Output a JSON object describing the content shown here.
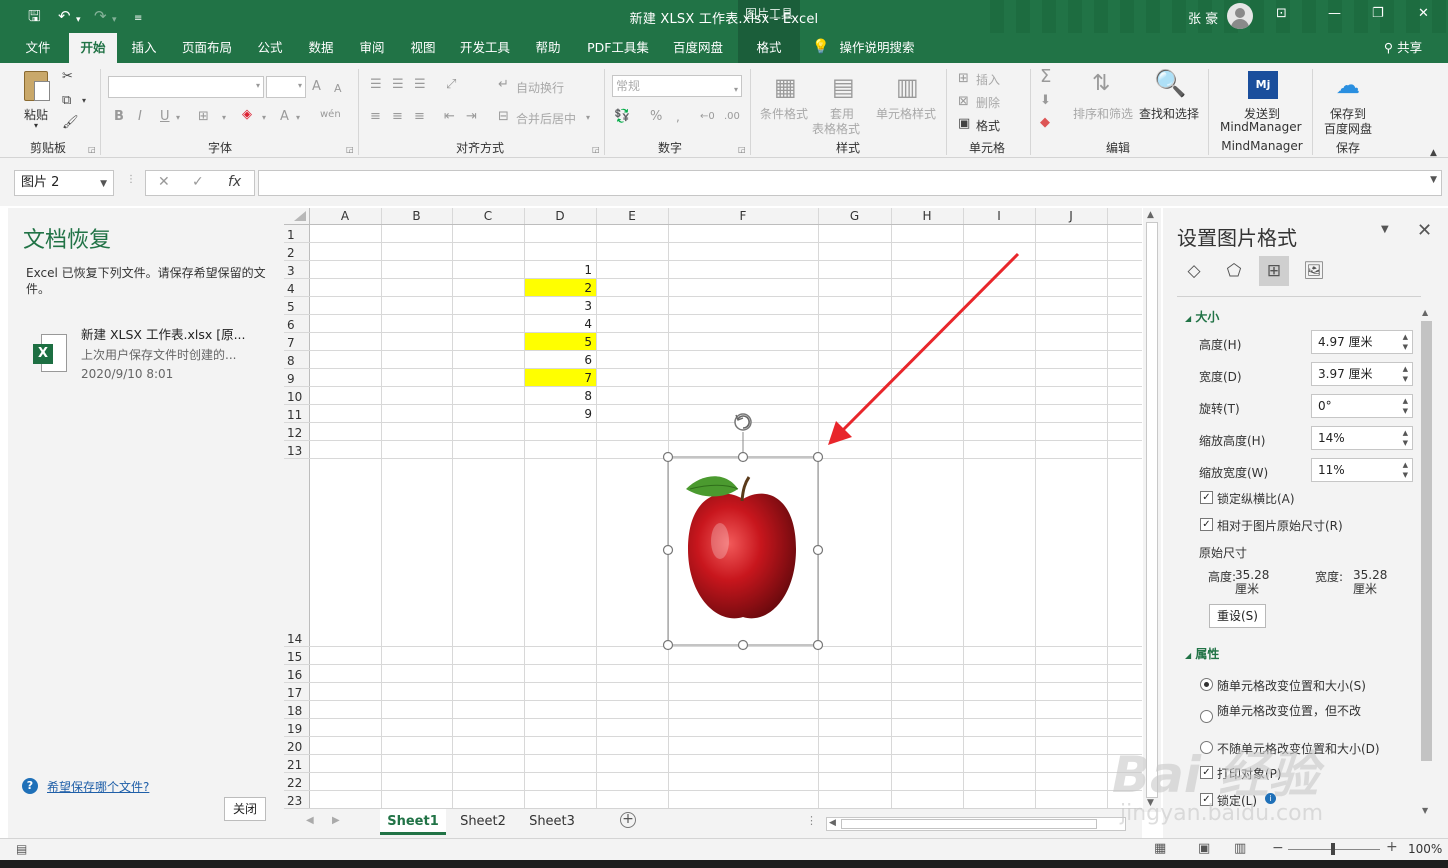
{
  "titlebar": {
    "title": "新建 XLSX 工作表.xlsx  -  Excel",
    "context_tab_group": "图片工具",
    "user_name": "张 豪"
  },
  "tabs": [
    "文件",
    "开始",
    "插入",
    "页面布局",
    "公式",
    "数据",
    "审阅",
    "视图",
    "开发工具",
    "帮助",
    "PDF工具集",
    "百度网盘",
    "格式"
  ],
  "active_tab": "开始",
  "tell_me": "操作说明搜索",
  "share": "共享",
  "ribbon": {
    "clipboard": {
      "paste": "粘贴",
      "label": "剪贴板"
    },
    "font": {
      "label": "字体",
      "bold": "B",
      "italic": "I",
      "underline": "U",
      "wen": "wén",
      "grow": "A",
      "shrink": "A"
    },
    "align": {
      "label": "对齐方式",
      "wrap": "自动换行",
      "merge": "合并后居中"
    },
    "number": {
      "label": "数字",
      "format": "常规",
      "percent": "%"
    },
    "styles": {
      "label": "样式",
      "cond": "条件格式",
      "table1": "套用",
      "table2": "表格格式",
      "cell": "单元格样式"
    },
    "cells": {
      "label": "单元格",
      "insert": "插入",
      "delete": "删除",
      "format": "格式"
    },
    "editing": {
      "label": "编辑",
      "sort": "排序和筛选",
      "find": "查找和选择"
    },
    "mindmanager": {
      "label": "MindManager",
      "send1": "发送到",
      "send2": "MindManager"
    },
    "save": {
      "label": "保存",
      "save1": "保存到",
      "save2": "百度网盘"
    }
  },
  "namebox": "图片 2",
  "fx": "fx",
  "recovery": {
    "title": "文档恢复",
    "desc": "Excel 已恢复下列文件。请保存希望保留的文件。",
    "file_name": "新建 XLSX 工作表.xlsx  [原...",
    "file_desc": "上次用户保存文件时创建的...",
    "file_date": "2020/9/10 8:01",
    "help_link": "希望保存哪个文件?",
    "close": "关闭"
  },
  "grid": {
    "columns": [
      "A",
      "B",
      "C",
      "D",
      "E",
      "F",
      "G",
      "H",
      "I",
      "J"
    ],
    "rows": [
      "1",
      "2",
      "3",
      "4",
      "5",
      "6",
      "7",
      "8",
      "9",
      "10",
      "11",
      "12",
      "13",
      "14",
      "15",
      "16",
      "17",
      "18",
      "19",
      "20",
      "21",
      "22",
      "23"
    ],
    "d_values": [
      "1",
      "2",
      "3",
      "4",
      "5",
      "6",
      "7",
      "8",
      "9"
    ],
    "highlight_rows": [
      4,
      7,
      9
    ],
    "highlight_color": "#ffff00"
  },
  "sheets": [
    "Sheet1",
    "Sheet2",
    "Sheet3"
  ],
  "active_sheet": "Sheet1",
  "zoom": "100%",
  "format_pane": {
    "title": "设置图片格式",
    "size_section": "大小",
    "height_label": "高度(H)",
    "height_value": "4.97 厘米",
    "width_label": "宽度(D)",
    "width_value": "3.97 厘米",
    "rotate_label": "旋转(T)",
    "rotate_value": "0°",
    "scale_h_label": "缩放高度(H)",
    "scale_h_value": "14%",
    "scale_w_label": "缩放宽度(W)",
    "scale_w_value": "11%",
    "lock_ratio": "锁定纵横比(A)",
    "relative": "相对于图片原始尺寸(R)",
    "original_size": "原始尺寸",
    "orig_h_label": "高度:",
    "orig_h_value": "35.28 厘米",
    "orig_w_label": "宽度:",
    "orig_w_value": "35.28 厘米",
    "reset": "重设(S)",
    "props_section": "属性",
    "prop1": "随单元格改变位置和大小(S)",
    "prop2": "随单元格改变位置，但不改变大小",
    "prop3": "不随单元格改变位置和大小(D)",
    "print": "打印对象(P)",
    "locked": "锁定(L)"
  },
  "watermark": {
    "text": "Bai 经验",
    "url": "jingyan.baidu.com"
  },
  "colors": {
    "excel_green": "#217346",
    "arrow_red": "#e8262b"
  }
}
